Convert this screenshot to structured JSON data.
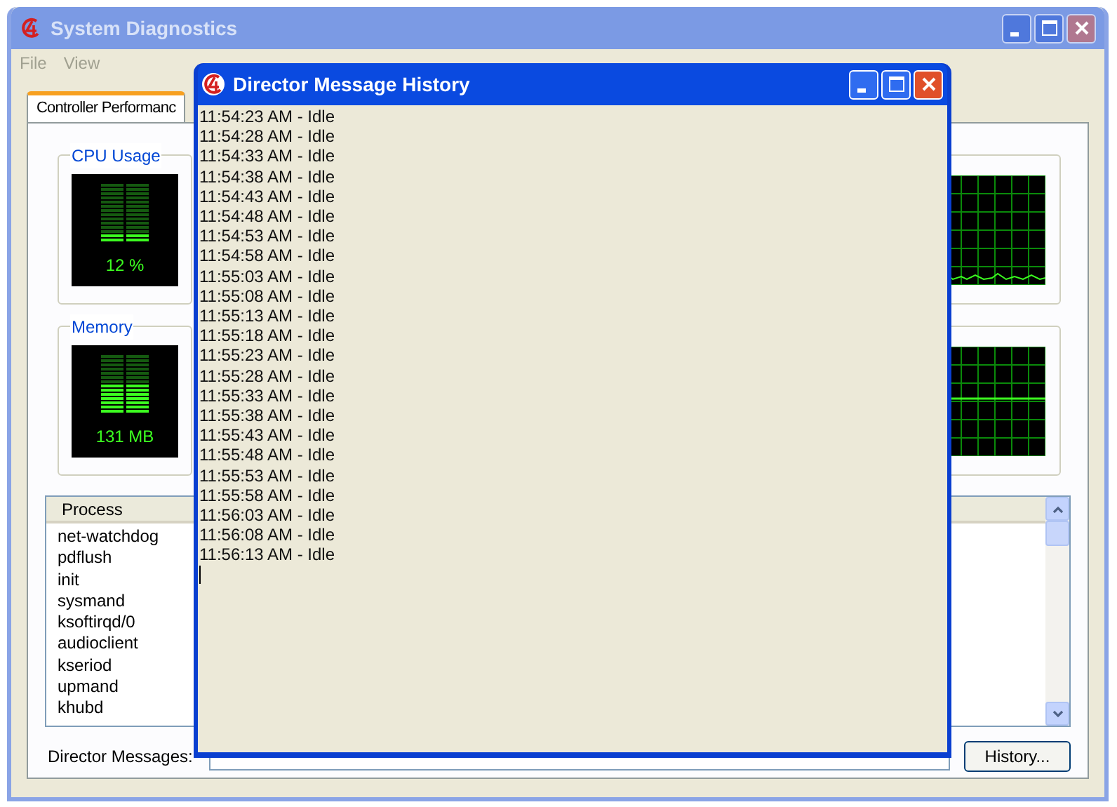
{
  "main_window": {
    "title": "System Diagnostics",
    "controls": [
      {
        "kind": "minimize"
      },
      {
        "kind": "maximize"
      },
      {
        "kind": "close"
      }
    ]
  },
  "menu": [
    "File",
    "View"
  ],
  "tabs": [
    {
      "label": "Controller Performanc",
      "selected": true
    }
  ],
  "meters": [
    {
      "title": "CPU Usage",
      "reading": "12 %",
      "level": 0.12
    },
    {
      "title": "Memory",
      "reading": "131 MB",
      "level": 0.5
    }
  ],
  "process_list": {
    "column": "Process",
    "rows": [
      "net-watchdog",
      "pdflush",
      "init",
      "sysmand",
      "ksoftirqd/0",
      "audioclient",
      "kseriod",
      "upmand",
      "khubd"
    ]
  },
  "director_messages": {
    "label": "Director Messages:"
  },
  "history_button": "History...",
  "dialog": {
    "title": "Director Message History",
    "controls": [
      {
        "kind": "minimize"
      },
      {
        "kind": "maximize"
      },
      {
        "kind": "close"
      }
    ],
    "lines": [
      "11:54:23 AM - Idle",
      "11:54:28 AM - Idle",
      "11:54:33 AM - Idle",
      "11:54:38 AM - Idle",
      "11:54:43 AM - Idle",
      "11:54:48 AM - Idle",
      "11:54:53 AM - Idle",
      "11:54:58 AM - Idle",
      "11:55:03 AM - Idle",
      "11:55:08 AM - Idle",
      "11:55:13 AM - Idle",
      "11:55:18 AM - Idle",
      "11:55:23 AM - Idle",
      "11:55:28 AM - Idle",
      "11:55:33 AM - Idle",
      "11:55:38 AM - Idle",
      "11:55:43 AM - Idle",
      "11:55:48 AM - Idle",
      "11:55:53 AM - Idle",
      "11:55:58 AM - Idle",
      "11:56:03 AM - Idle",
      "11:56:08 AM - Idle",
      "11:56:13 AM - Idle"
    ]
  }
}
